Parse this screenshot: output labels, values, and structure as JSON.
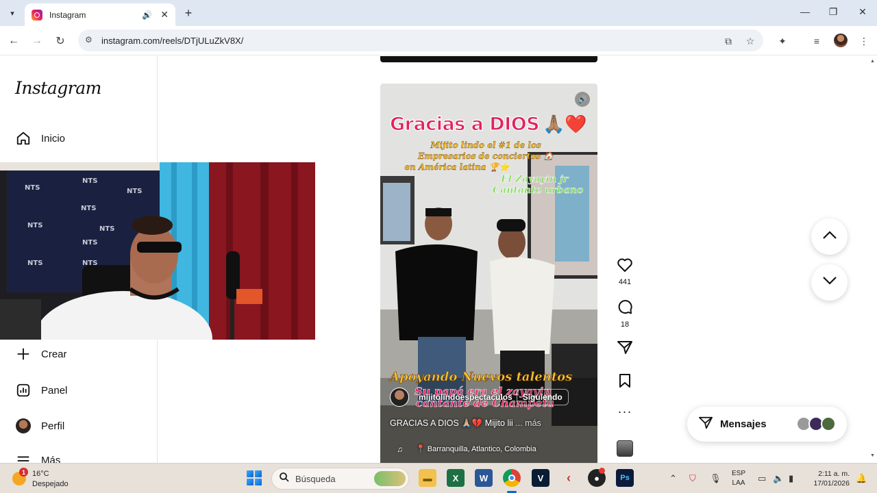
{
  "browser": {
    "tab": {
      "title": "Instagram"
    },
    "url": "instagram.com/reels/DTjULuZkV8X/"
  },
  "sidebar": {
    "logo": "Instagram",
    "items": [
      {
        "label": "Inicio",
        "icon": "home-icon"
      },
      {
        "label": "Crear",
        "icon": "plus-icon"
      },
      {
        "label": "Panel",
        "icon": "chart-icon"
      },
      {
        "label": "Perfil",
        "icon": "avatar"
      },
      {
        "label": "Más",
        "icon": "menu-icon"
      }
    ]
  },
  "reel": {
    "title": "Gracias a DIOS",
    "title_emoji": "🙏🏽❤️",
    "subtitle_lines": [
      "Mijito lindo el #1 de los",
      "Empresarios de conciertos 🏠",
      "en América latina 🏆⭐"
    ],
    "green_lines": [
      "El Zayayin jr",
      "Cantante urbano"
    ],
    "yellow_caption": "Apoyando Nuevos talentos",
    "red_caption_lines": [
      "Su papá era el zayayin",
      "cantante de Champeta"
    ],
    "author": "mijitolindoespectaculos",
    "follow_label": "Siguiendo",
    "caption": "GRACIAS A DIOS 🙏🏼💔 Mijito lii",
    "caption_more": "... más",
    "location": "Barranquilla, Atlantico, Colombia"
  },
  "actions": {
    "likes": "441",
    "comments": "18"
  },
  "messages": {
    "label": "Mensajes"
  },
  "taskbar": {
    "badge": "1",
    "temperature": "16°C",
    "condition": "Despejado",
    "search_placeholder": "Búsqueda",
    "lang_top": "ESP",
    "lang_bottom": "LAA",
    "time": "2:11 a. m.",
    "date": "17/01/2026"
  },
  "colors": {
    "reel_title": "#e0245e",
    "reel_yellow": "#f4c430",
    "reel_green": "#7ed957",
    "taskbar_bg": "#e7e1da",
    "tabbar_bg": "#dfe7f2"
  }
}
